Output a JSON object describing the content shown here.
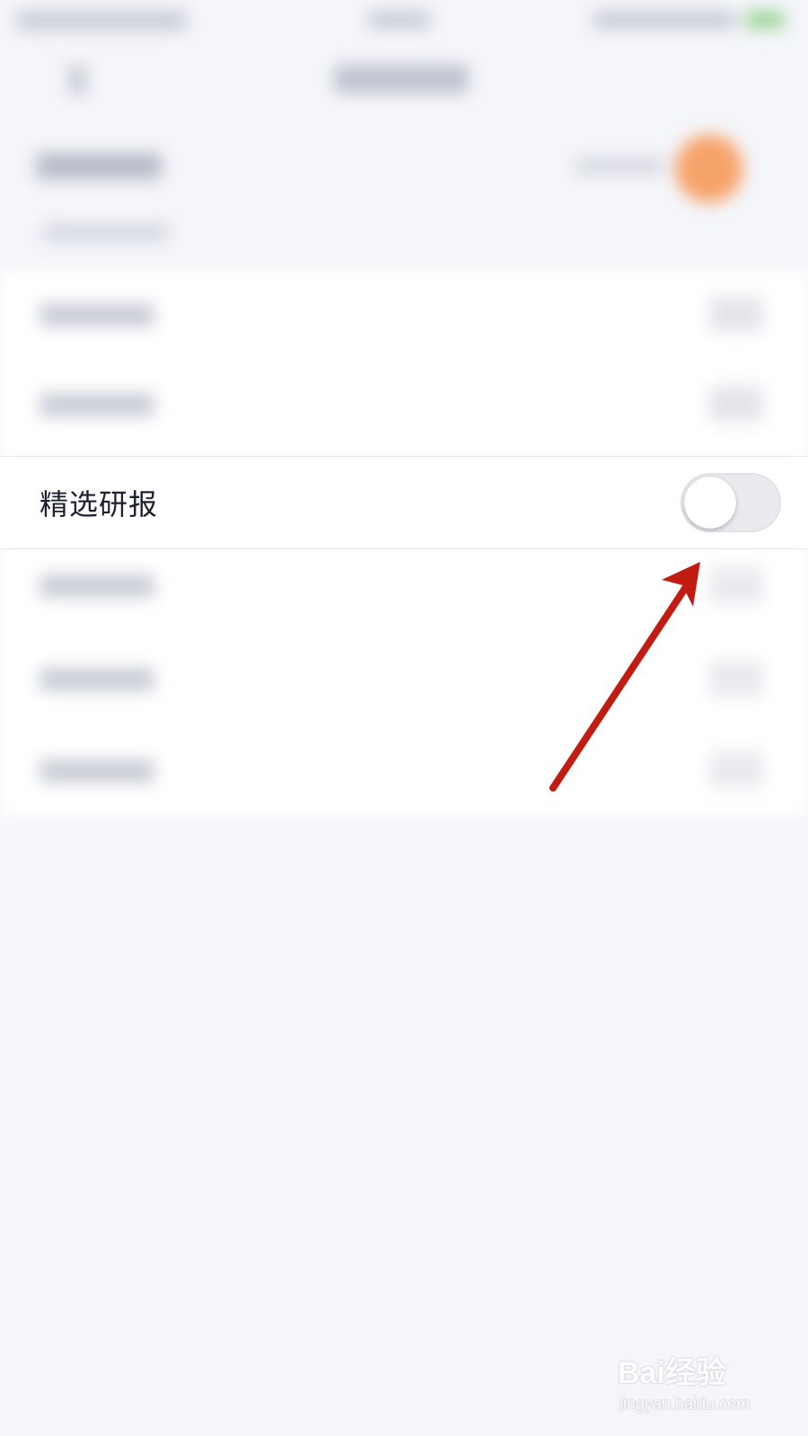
{
  "setting": {
    "label": "精选研报",
    "toggle_on": false
  },
  "colors": {
    "page_background": "#f5f6fa",
    "row_background": "#ffffff",
    "label_text": "#1d2030",
    "toggle_track_off": "#e9e9ee",
    "annotation_arrow": "#c01c12",
    "blurred_avatar": "#f6a36a"
  },
  "annotation": {
    "type": "arrow",
    "points_to": "toggle-switch"
  },
  "watermark": {
    "main": "Bai经验",
    "sub": "jingyan.baidu.com"
  }
}
